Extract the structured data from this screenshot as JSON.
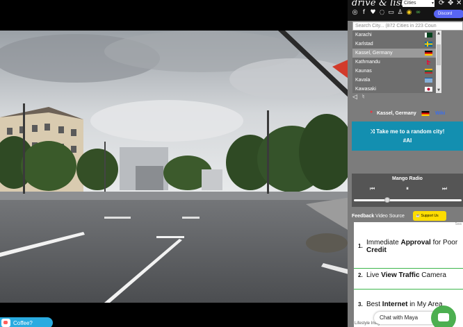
{
  "panel": {
    "brand": "drive & listen",
    "cities_select": "Cities",
    "discord_label": "Discord",
    "search_placeholder": "Search City... (872 Cities in 223 Coun",
    "cities": [
      {
        "name": "Karachi",
        "flag": "pakistan"
      },
      {
        "name": "Karlstad",
        "flag": "sweden"
      },
      {
        "name": "Kassel, Germany",
        "flag": "germany",
        "selected": true
      },
      {
        "name": "Kathmandu",
        "flag": "nepal"
      },
      {
        "name": "Kaunas",
        "flag": "lithuania"
      },
      {
        "name": "Kavala",
        "flag": "greece"
      },
      {
        "name": "Kawasaki",
        "flag": "japan"
      }
    ],
    "current_location": "Kassel, Germany",
    "wiki_label": "Wiki",
    "random_line1": "Take me to a random city!",
    "random_line2": "#AI",
    "radio_title": "Mango Radio",
    "radio_position_percent": 31,
    "feedback_label": "Feedback",
    "video_source_label": "Video Source",
    "support_label": "Support Us",
    "ads_search_label": "Sea",
    "ads": [
      {
        "num": "1.",
        "pre": "Immediate ",
        "bold": "Approval",
        "post": " for Poor",
        "line2_bold": "Credit"
      },
      {
        "num": "2.",
        "pre": "Live ",
        "bold": "View Traffic",
        "post": " Camera",
        "line2_bold": ""
      },
      {
        "num": "3.",
        "pre": "Best ",
        "bold": "Internet",
        "post": " in My Area",
        "line2_bold": ""
      }
    ],
    "ads_footer": "Lifestyle Insights"
  },
  "coffee_label": "Coffee?",
  "chat_label": "Chat with Maya",
  "colors": {
    "random_button": "#138fb0",
    "discord": "#5865f2",
    "support": "#ffdd00",
    "chat": "#4caf50"
  }
}
